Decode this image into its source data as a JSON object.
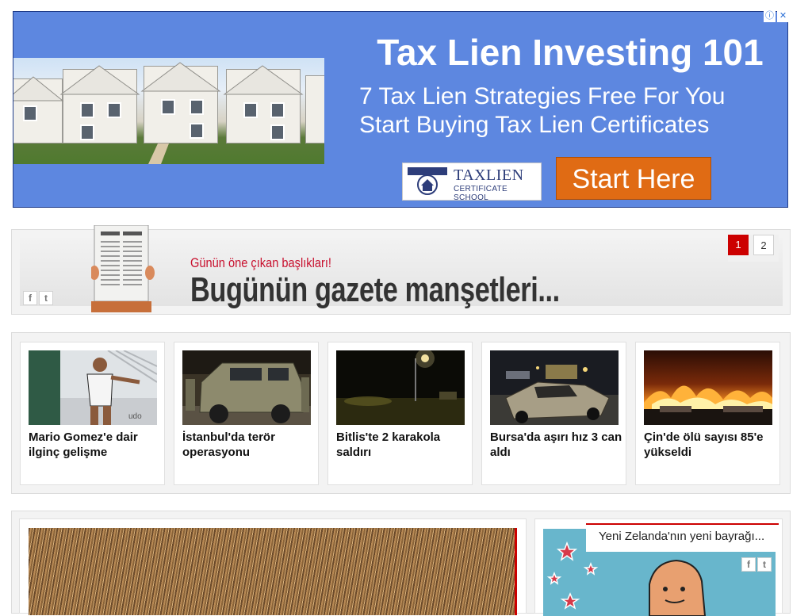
{
  "ad": {
    "title": "Tax Lien Investing 101",
    "subtitle_line1": "7 Tax Lien Strategies Free For You",
    "subtitle_line2": "Start Buying Tax Lien Certificates",
    "logo_brand": "TAXLIEN",
    "logo_tagline": "CERTIFICATE SCHOOL",
    "logo_badge": "TAX LIEN",
    "cta_label": "Start Here",
    "info_icon": "info-icon",
    "close_icon": "close-icon",
    "colors": {
      "background": "#5d87e0",
      "cta": "#e06b14"
    }
  },
  "headlines": {
    "kicker": "Günün öne çıkan başlıkları!",
    "title": "Bugünün gazete manşetleri...",
    "pages": [
      "1",
      "2"
    ],
    "active_page": "1",
    "social": [
      "facebook-icon",
      "twitter-icon"
    ]
  },
  "news": [
    {
      "caption": "Mario Gomez'e dair ilginç gelişme"
    },
    {
      "caption": "İstanbul'da terör operasyonu"
    },
    {
      "caption": "Bitlis'te 2 karakola saldırı"
    },
    {
      "caption": "Bursa'da aşırı hız 3 can aldı"
    },
    {
      "caption": "Çin'de ölü sayısı 85'e yükseldi"
    }
  ],
  "feature": {
    "side_title": "Yeni Zelanda'nın yeni bayrağı...",
    "social": [
      "facebook-icon",
      "twitter-icon"
    ]
  },
  "colors": {
    "accent": "#cc0000"
  }
}
